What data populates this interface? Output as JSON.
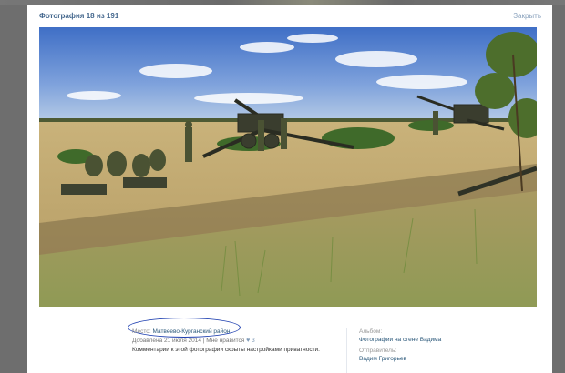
{
  "viewer": {
    "counter": "Фотография 18 из 191",
    "close_label": "Закрыть"
  },
  "photo": {
    "alt": "Артиллерийские орудия в поле"
  },
  "info": {
    "place_label": "Место:",
    "place_value": "Матвеево-Курганский район",
    "date_text": "Добавлена 21 июля 2014",
    "likes_label": "Мне нравится",
    "likes_icon": "heart-icon",
    "likes_count": "3",
    "privacy_note": "Комментарии к этой фотографии скрыты настройками приватности."
  },
  "side": {
    "album_label": "Альбом:",
    "album_value": "Фотографии на стене Вадима",
    "sender_label": "Отправитель:",
    "sender_value": "Вадим Григорьев"
  },
  "colors": {
    "link": "#2b587a",
    "accent": "#45688e",
    "annotation_circle": "#1e3fb0"
  }
}
